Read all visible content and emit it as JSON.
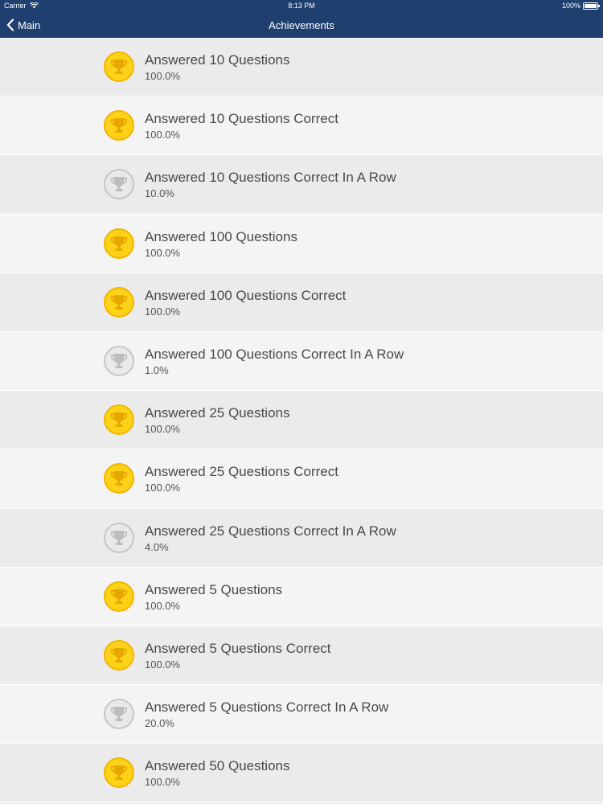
{
  "status_bar": {
    "carrier": "Carrier",
    "time": "8:13 PM",
    "battery": "100%"
  },
  "nav": {
    "back_label": "Main",
    "title": "Achievements"
  },
  "colors": {
    "header_bg": "#1f3f6f",
    "gold_badge": "#ffd21a",
    "gold_trophy": "#e6a800",
    "grey_badge": "#e9e9e9",
    "grey_trophy": "#bdbdbd"
  },
  "achievements": [
    {
      "title": "Answered 10 Questions",
      "value": "100.0%",
      "unlocked": true
    },
    {
      "title": "Answered 10 Questions Correct",
      "value": "100.0%",
      "unlocked": true
    },
    {
      "title": "Answered 10 Questions Correct In A Row",
      "value": "10.0%",
      "unlocked": false
    },
    {
      "title": "Answered 100 Questions",
      "value": "100.0%",
      "unlocked": true
    },
    {
      "title": "Answered 100 Questions Correct",
      "value": "100.0%",
      "unlocked": true
    },
    {
      "title": "Answered 100 Questions Correct In A Row",
      "value": "1.0%",
      "unlocked": false
    },
    {
      "title": "Answered 25 Questions",
      "value": "100.0%",
      "unlocked": true
    },
    {
      "title": "Answered 25 Questions Correct",
      "value": "100.0%",
      "unlocked": true
    },
    {
      "title": "Answered 25 Questions Correct In A Row",
      "value": "4.0%",
      "unlocked": false
    },
    {
      "title": "Answered 5 Questions",
      "value": "100.0%",
      "unlocked": true
    },
    {
      "title": "Answered 5 Questions Correct",
      "value": "100.0%",
      "unlocked": true
    },
    {
      "title": "Answered 5 Questions Correct In A Row",
      "value": "20.0%",
      "unlocked": false
    },
    {
      "title": "Answered 50 Questions",
      "value": "100.0%",
      "unlocked": true
    }
  ]
}
